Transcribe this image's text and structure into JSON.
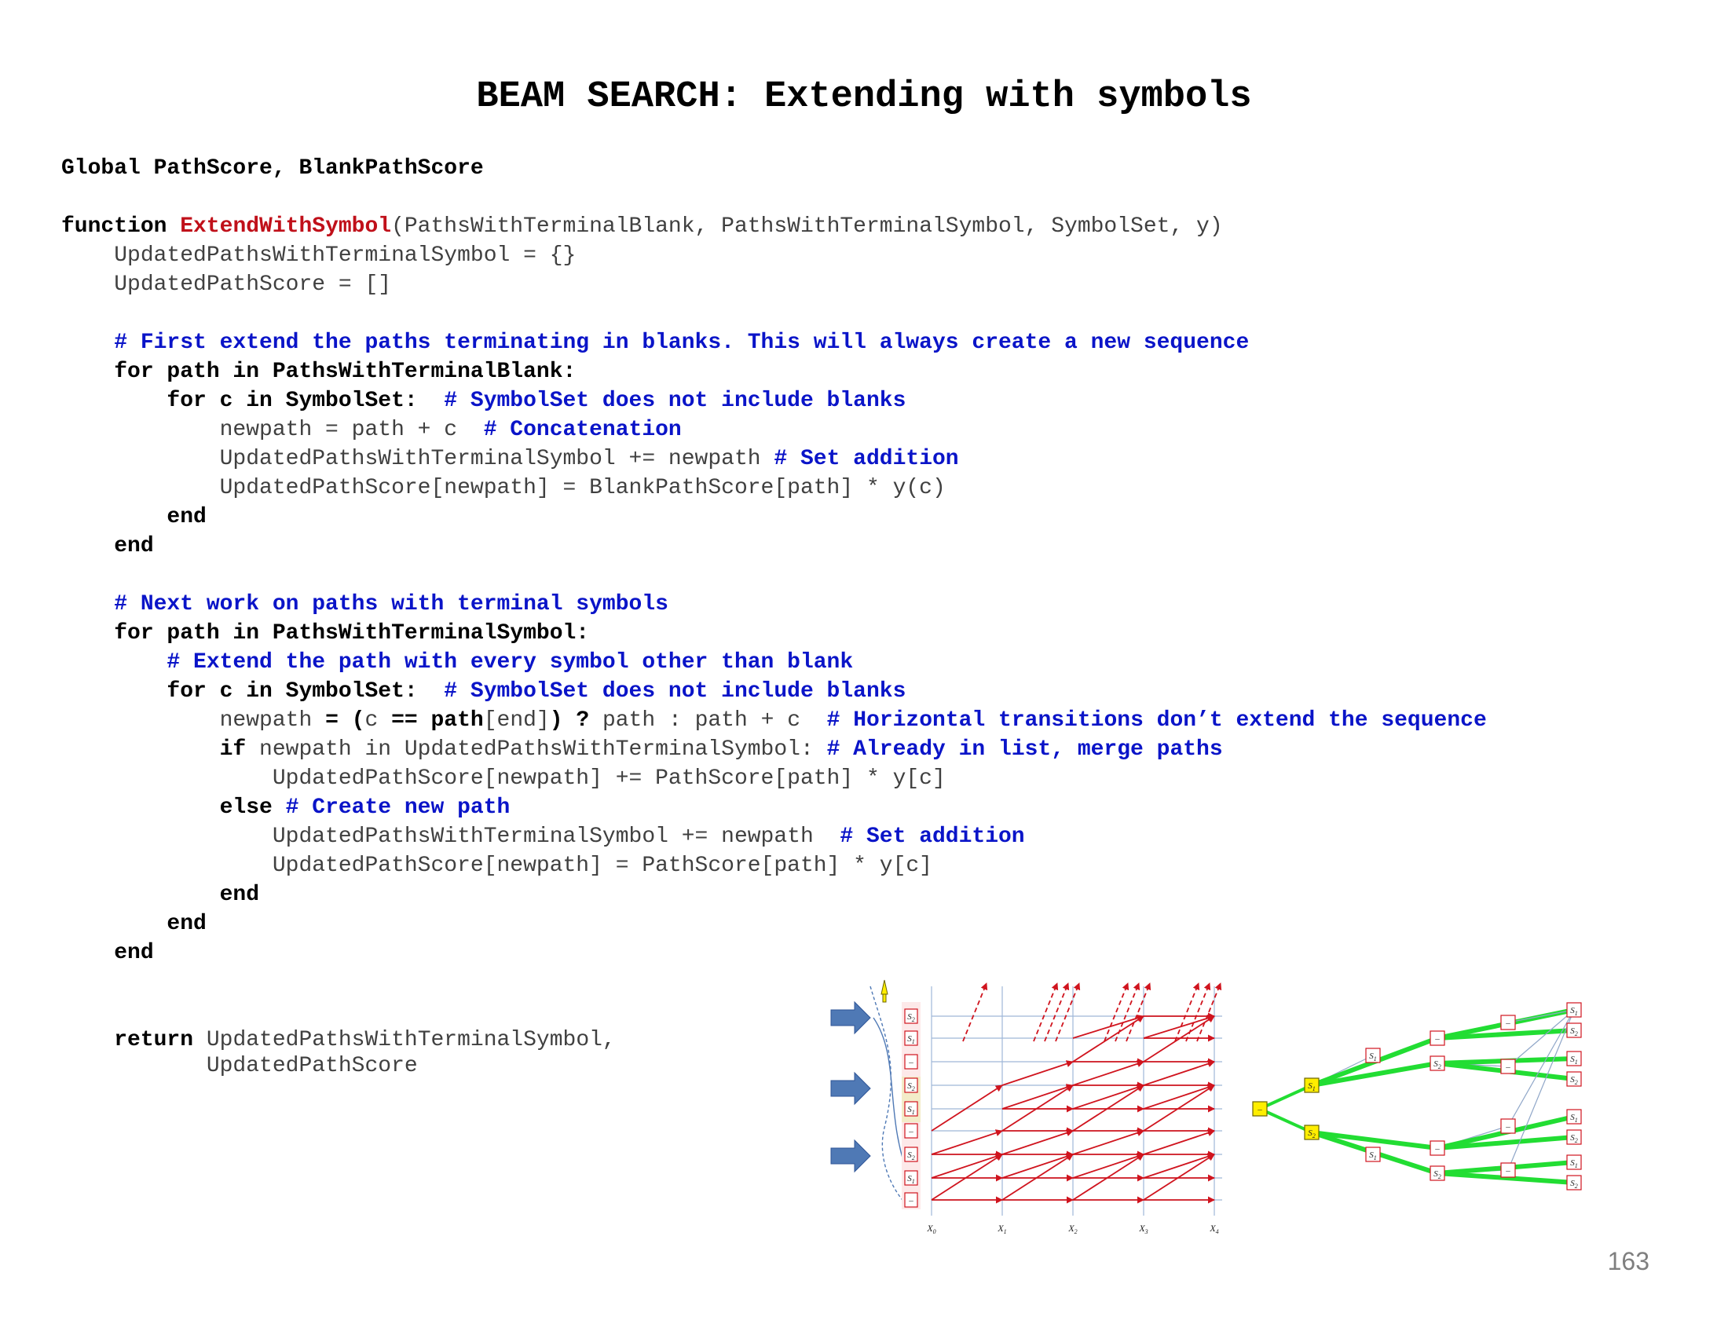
{
  "title": "BEAM SEARCH: Extending with symbols",
  "code": {
    "lines": [
      [
        {
          "k": "kw",
          "t": "Global PathScore, BlankPathScore"
        }
      ],
      [],
      [
        {
          "k": "kw",
          "t": "function "
        },
        {
          "k": "fn",
          "t": "ExtendWithSymbol"
        },
        {
          "k": "tx",
          "t": "(PathsWithTerminalBlank, PathsWithTerminalSymbol, SymbolSet, y)"
        }
      ],
      [
        {
          "k": "tx",
          "t": "    UpdatedPathsWithTerminalSymbol = {}"
        }
      ],
      [
        {
          "k": "tx",
          "t": "    UpdatedPathScore = []"
        }
      ],
      [],
      [
        {
          "k": "cm",
          "t": "    # First extend the paths terminating in blanks. This will always create a new sequence"
        }
      ],
      [
        {
          "k": "kw",
          "t": "    for path in PathsWithTerminalBlank:"
        }
      ],
      [
        {
          "k": "kw",
          "t": "        for c in SymbolSet:  "
        },
        {
          "k": "cm",
          "t": "# SymbolSet does not include blanks"
        }
      ],
      [
        {
          "k": "tx",
          "t": "            newpath = path + c  "
        },
        {
          "k": "cm",
          "t": "# Concatenation"
        }
      ],
      [
        {
          "k": "tx",
          "t": "            UpdatedPathsWithTerminalSymbol += newpath "
        },
        {
          "k": "cm",
          "t": "# Set addition"
        }
      ],
      [
        {
          "k": "tx",
          "t": "            UpdatedPathScore[newpath] = BlankPathScore[path] * y(c)"
        }
      ],
      [
        {
          "k": "kw",
          "t": "        end"
        }
      ],
      [
        {
          "k": "kw",
          "t": "    end"
        }
      ],
      [],
      [
        {
          "k": "cm",
          "t": "    # Next work on paths with terminal symbols"
        }
      ],
      [
        {
          "k": "kw",
          "t": "    for path in PathsWithTerminalSymbol:"
        }
      ],
      [
        {
          "k": "cm",
          "t": "        # Extend the path with every symbol other than blank"
        }
      ],
      [
        {
          "k": "kw",
          "t": "        for c in SymbolSet:  "
        },
        {
          "k": "cm",
          "t": "# SymbolSet does not include blanks"
        }
      ],
      [
        {
          "k": "tx",
          "t": "            newpath "
        },
        {
          "k": "kw",
          "t": "= ("
        },
        {
          "k": "tx",
          "t": "c "
        },
        {
          "k": "kw",
          "t": "== path"
        },
        {
          "k": "tx",
          "t": "[end]"
        },
        {
          "k": "kw",
          "t": ") ? "
        },
        {
          "k": "tx",
          "t": "path : path + c  "
        },
        {
          "k": "cm",
          "t": "# Horizontal transitions don’t extend the sequence"
        }
      ],
      [
        {
          "k": "kw",
          "t": "            if "
        },
        {
          "k": "tx",
          "t": "newpath in UpdatedPathsWithTerminalSymbol: "
        },
        {
          "k": "cm",
          "t": "# Already in list, merge paths"
        }
      ],
      [
        {
          "k": "tx",
          "t": "                UpdatedPathScore[newpath] += PathScore[path] * y[c]"
        }
      ],
      [
        {
          "k": "kw",
          "t": "            else "
        },
        {
          "k": "cm",
          "t": "# Create new path"
        }
      ],
      [
        {
          "k": "tx",
          "t": "                UpdatedPathsWithTerminalSymbol += newpath  "
        },
        {
          "k": "cm",
          "t": "# Set addition"
        }
      ],
      [
        {
          "k": "tx",
          "t": "                UpdatedPathScore[newpath] = PathScore[path] * y[c]"
        }
      ],
      [
        {
          "k": "kw",
          "t": "            end"
        }
      ],
      [
        {
          "k": "kw",
          "t": "        end"
        }
      ],
      [
        {
          "k": "kw",
          "t": "    end"
        }
      ],
      [],
      [],
      [
        {
          "k": "kw",
          "t": "    return "
        },
        {
          "k": "tx",
          "t": "UpdatedPathsWithTerminalSymbol,"
        }
      ],
      [
        {
          "k": "tx",
          "t": "           UpdatedPathScore"
        }
      ]
    ]
  },
  "figure": {
    "trellis_x_labels": [
      "X0",
      "X1",
      "X2",
      "X3",
      "X4"
    ],
    "column_labels": [
      "S2",
      "S1",
      "–",
      "S2",
      "S1",
      "–",
      "S2",
      "S1",
      "–"
    ],
    "tree_labels": {
      "root": "–",
      "level1": [
        "S1",
        "S2"
      ],
      "level2": [
        "S1",
        "–",
        "S2",
        "S1",
        "–",
        "S2"
      ],
      "leaves": [
        "S1",
        "S2",
        "S1",
        "S2",
        "S1",
        "S2",
        "S1",
        "S2"
      ]
    },
    "colors": {
      "trellis_edges": "#d0141e",
      "grid": "#9fb8d8",
      "arrows": "#4f79b5",
      "tree_edges": "#22dd33",
      "highlight": "#ffee00"
    }
  },
  "page_number": "163"
}
